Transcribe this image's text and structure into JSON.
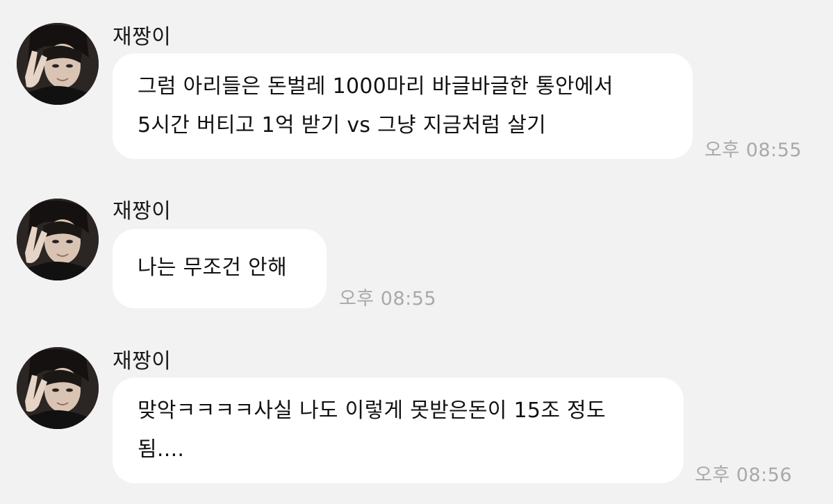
{
  "messages": [
    {
      "sender": "재짱이",
      "lines": [
        "그럼 아리들은 돈벌레 1000마리 바글바글한 통안에서",
        "5시간 버티고 1억 받기 vs 그냥 지금처럼 살기"
      ],
      "time": "오후 08:55"
    },
    {
      "sender": "재짱이",
      "lines": [
        "나는 무조건 안해"
      ],
      "time": "오후 08:55"
    },
    {
      "sender": "재짱이",
      "lines": [
        "맞악ㅋㅋㅋㅋ사실 나도 이렇게 못받은돈이 15조 정도",
        "됨...."
      ],
      "time": "오후 08:56"
    }
  ],
  "colors": {
    "background": "#f2f2f2",
    "bubble": "#ffffff",
    "text": "#111111",
    "timestamp": "#a9a9a9"
  },
  "icons": {
    "avatar": "profile-photo"
  }
}
